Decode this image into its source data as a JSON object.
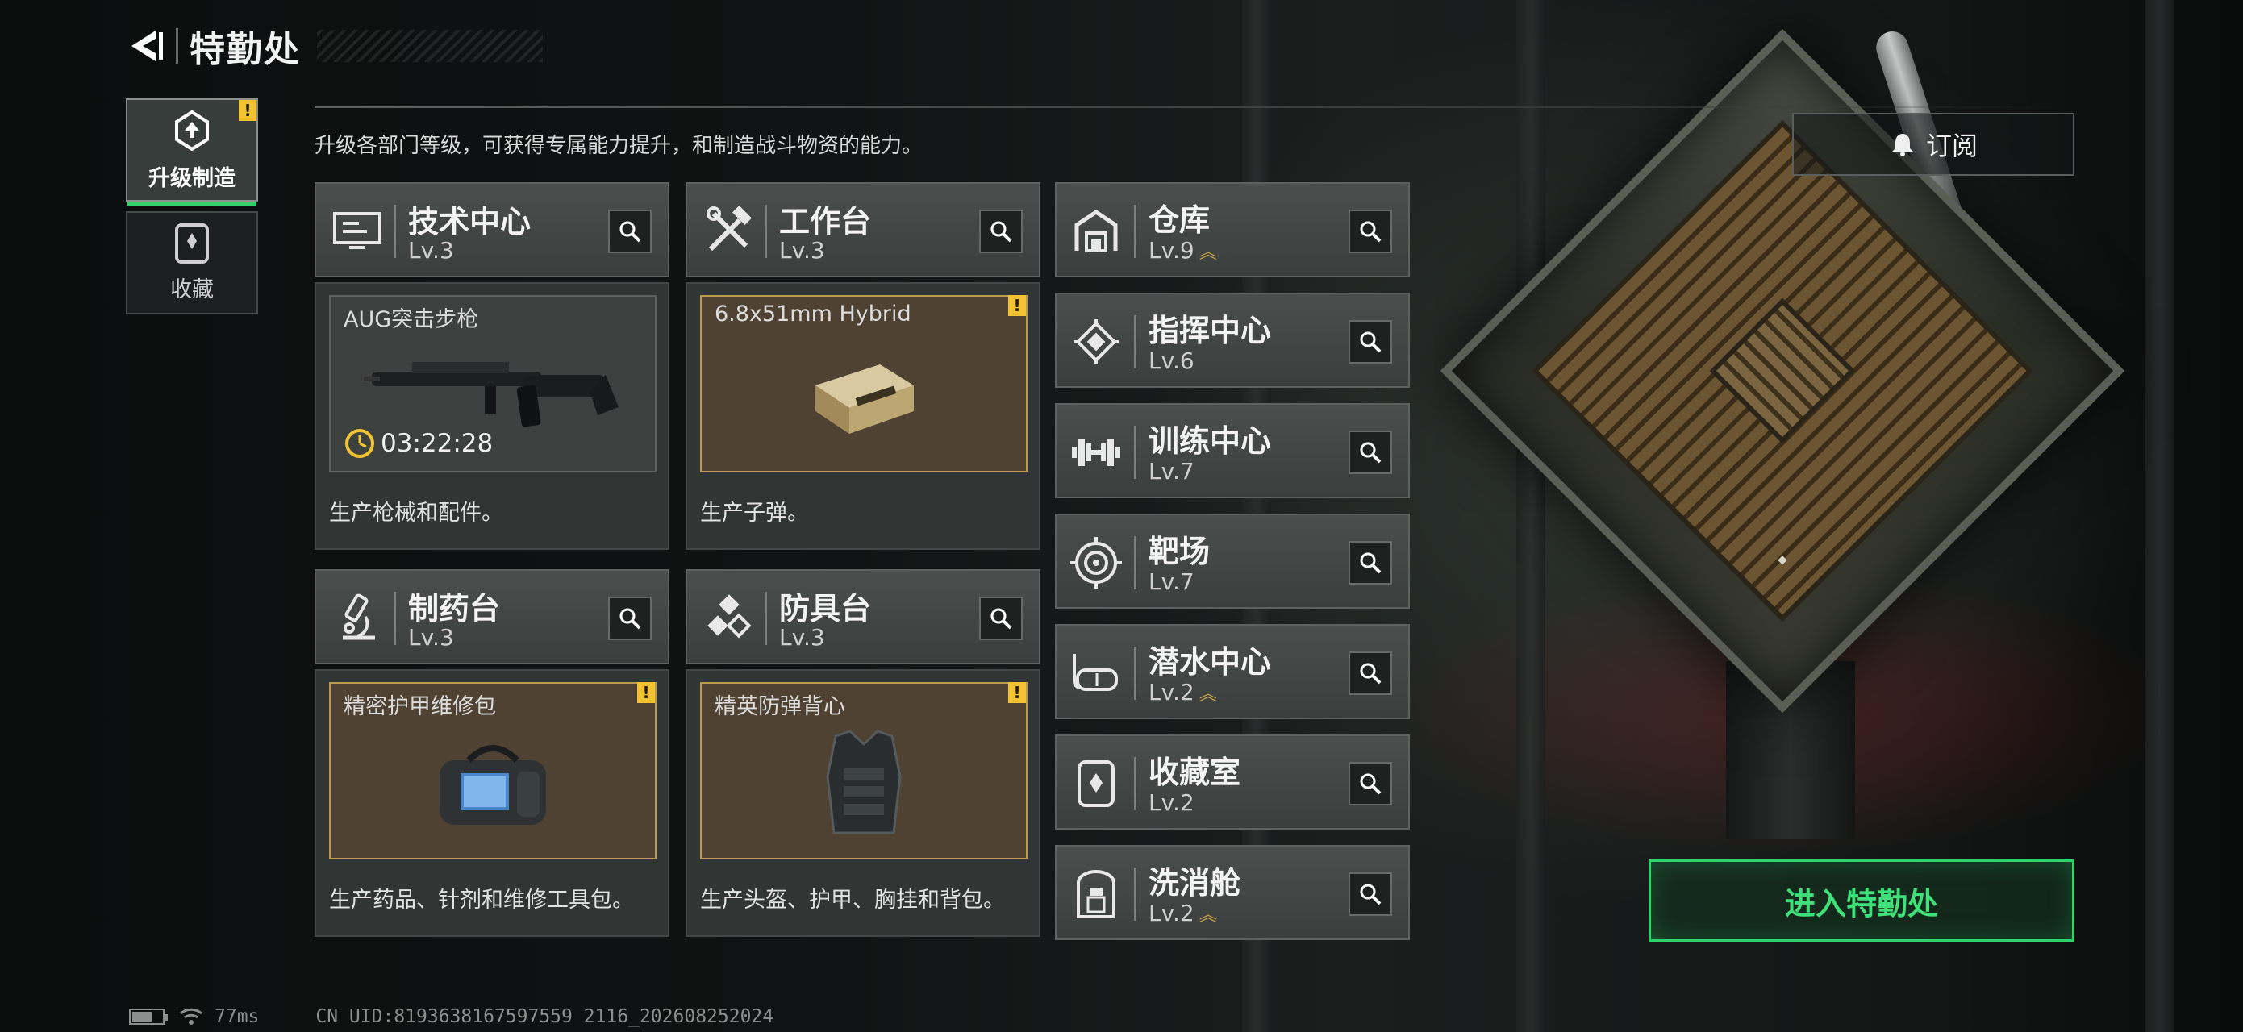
{
  "header": {
    "title": "特勤处"
  },
  "tabs": [
    {
      "label": "升级制造",
      "active": true,
      "alert": "!"
    },
    {
      "label": "收藏",
      "active": false
    }
  ],
  "description": "升级各部门等级，可获得专属能力提升，和制造战斗物资的能力。",
  "subscribe_label": "订阅",
  "cards": [
    {
      "name": "技术中心",
      "level": "Lv.3",
      "icon": "monitor-icon",
      "product": "AUG突击步枪",
      "timer": "03:22:28",
      "ready": false,
      "desc": "生产枪械和配件。"
    },
    {
      "name": "工作台",
      "level": "Lv.3",
      "icon": "tools-icon",
      "product": "6.8x51mm Hybrid",
      "ready": true,
      "alert": "!",
      "desc": "生产子弹。"
    },
    {
      "name": "制药台",
      "level": "Lv.3",
      "icon": "microscope-icon",
      "product": "精密护甲维修包",
      "ready": true,
      "alert": "!",
      "desc": "生产药品、针剂和维修工具包。"
    },
    {
      "name": "防具台",
      "level": "Lv.3",
      "icon": "cubes-icon",
      "product": "精英防弹背心",
      "ready": true,
      "alert": "!",
      "desc": "生产头盔、护甲、胸挂和背包。"
    }
  ],
  "departments": [
    {
      "name": "仓库",
      "level": "Lv.9",
      "upgradable": true,
      "icon": "warehouse-icon"
    },
    {
      "name": "指挥中心",
      "level": "Lv.6",
      "upgradable": false,
      "icon": "command-icon"
    },
    {
      "name": "训练中心",
      "level": "Lv.7",
      "upgradable": false,
      "icon": "dumbbell-icon"
    },
    {
      "name": "靶场",
      "level": "Lv.7",
      "upgradable": false,
      "icon": "target-icon"
    },
    {
      "name": "潜水中心",
      "level": "Lv.2",
      "upgradable": true,
      "icon": "diving-mask-icon"
    },
    {
      "name": "收藏室",
      "level": "Lv.2",
      "upgradable": false,
      "icon": "collection-icon"
    },
    {
      "name": "洗消舱",
      "level": "Lv.2",
      "upgradable": true,
      "icon": "decon-icon"
    }
  ],
  "upgrade_marker": "︽",
  "enter_label": "进入特勤处",
  "footer": {
    "ping": "77ms",
    "uid": "CN UID:8193638167597559 2116_202608252024"
  },
  "colors": {
    "accent_green": "#33d06b",
    "alert_yellow": "#f2c230",
    "ready_border": "#b99a4e"
  }
}
